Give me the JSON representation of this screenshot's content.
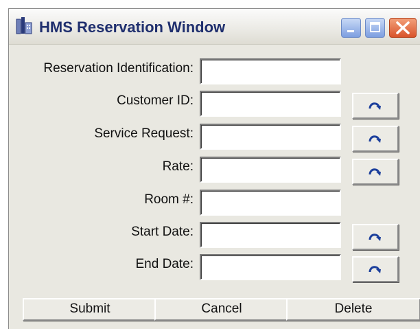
{
  "window": {
    "title": "HMS Reservation Window",
    "icons": {
      "app": "hms-app-icon",
      "minimize": "minimize-icon",
      "maximize": "maximize-icon",
      "close": "close-icon",
      "lookup": "lookup-arrow-icon"
    },
    "colors": {
      "title_text": "#1f2f6e",
      "lookup_arrow": "#1c3f9c",
      "close_button": "#d9542b",
      "window_bg": "#e9e8e1"
    }
  },
  "form": {
    "reservation_id": {
      "label": "Reservation Identification:",
      "value": ""
    },
    "customer_id": {
      "label": "Customer ID:",
      "value": ""
    },
    "service_request": {
      "label": "Service Request:",
      "value": ""
    },
    "rate": {
      "label": "Rate:",
      "value": ""
    },
    "room": {
      "label": "Room #:",
      "value": ""
    },
    "start_date": {
      "label": "Start Date:",
      "value": ""
    },
    "end_date": {
      "label": "End Date:",
      "value": ""
    }
  },
  "actions": {
    "submit": "Submit",
    "cancel": "Cancel",
    "delete": "Delete"
  }
}
